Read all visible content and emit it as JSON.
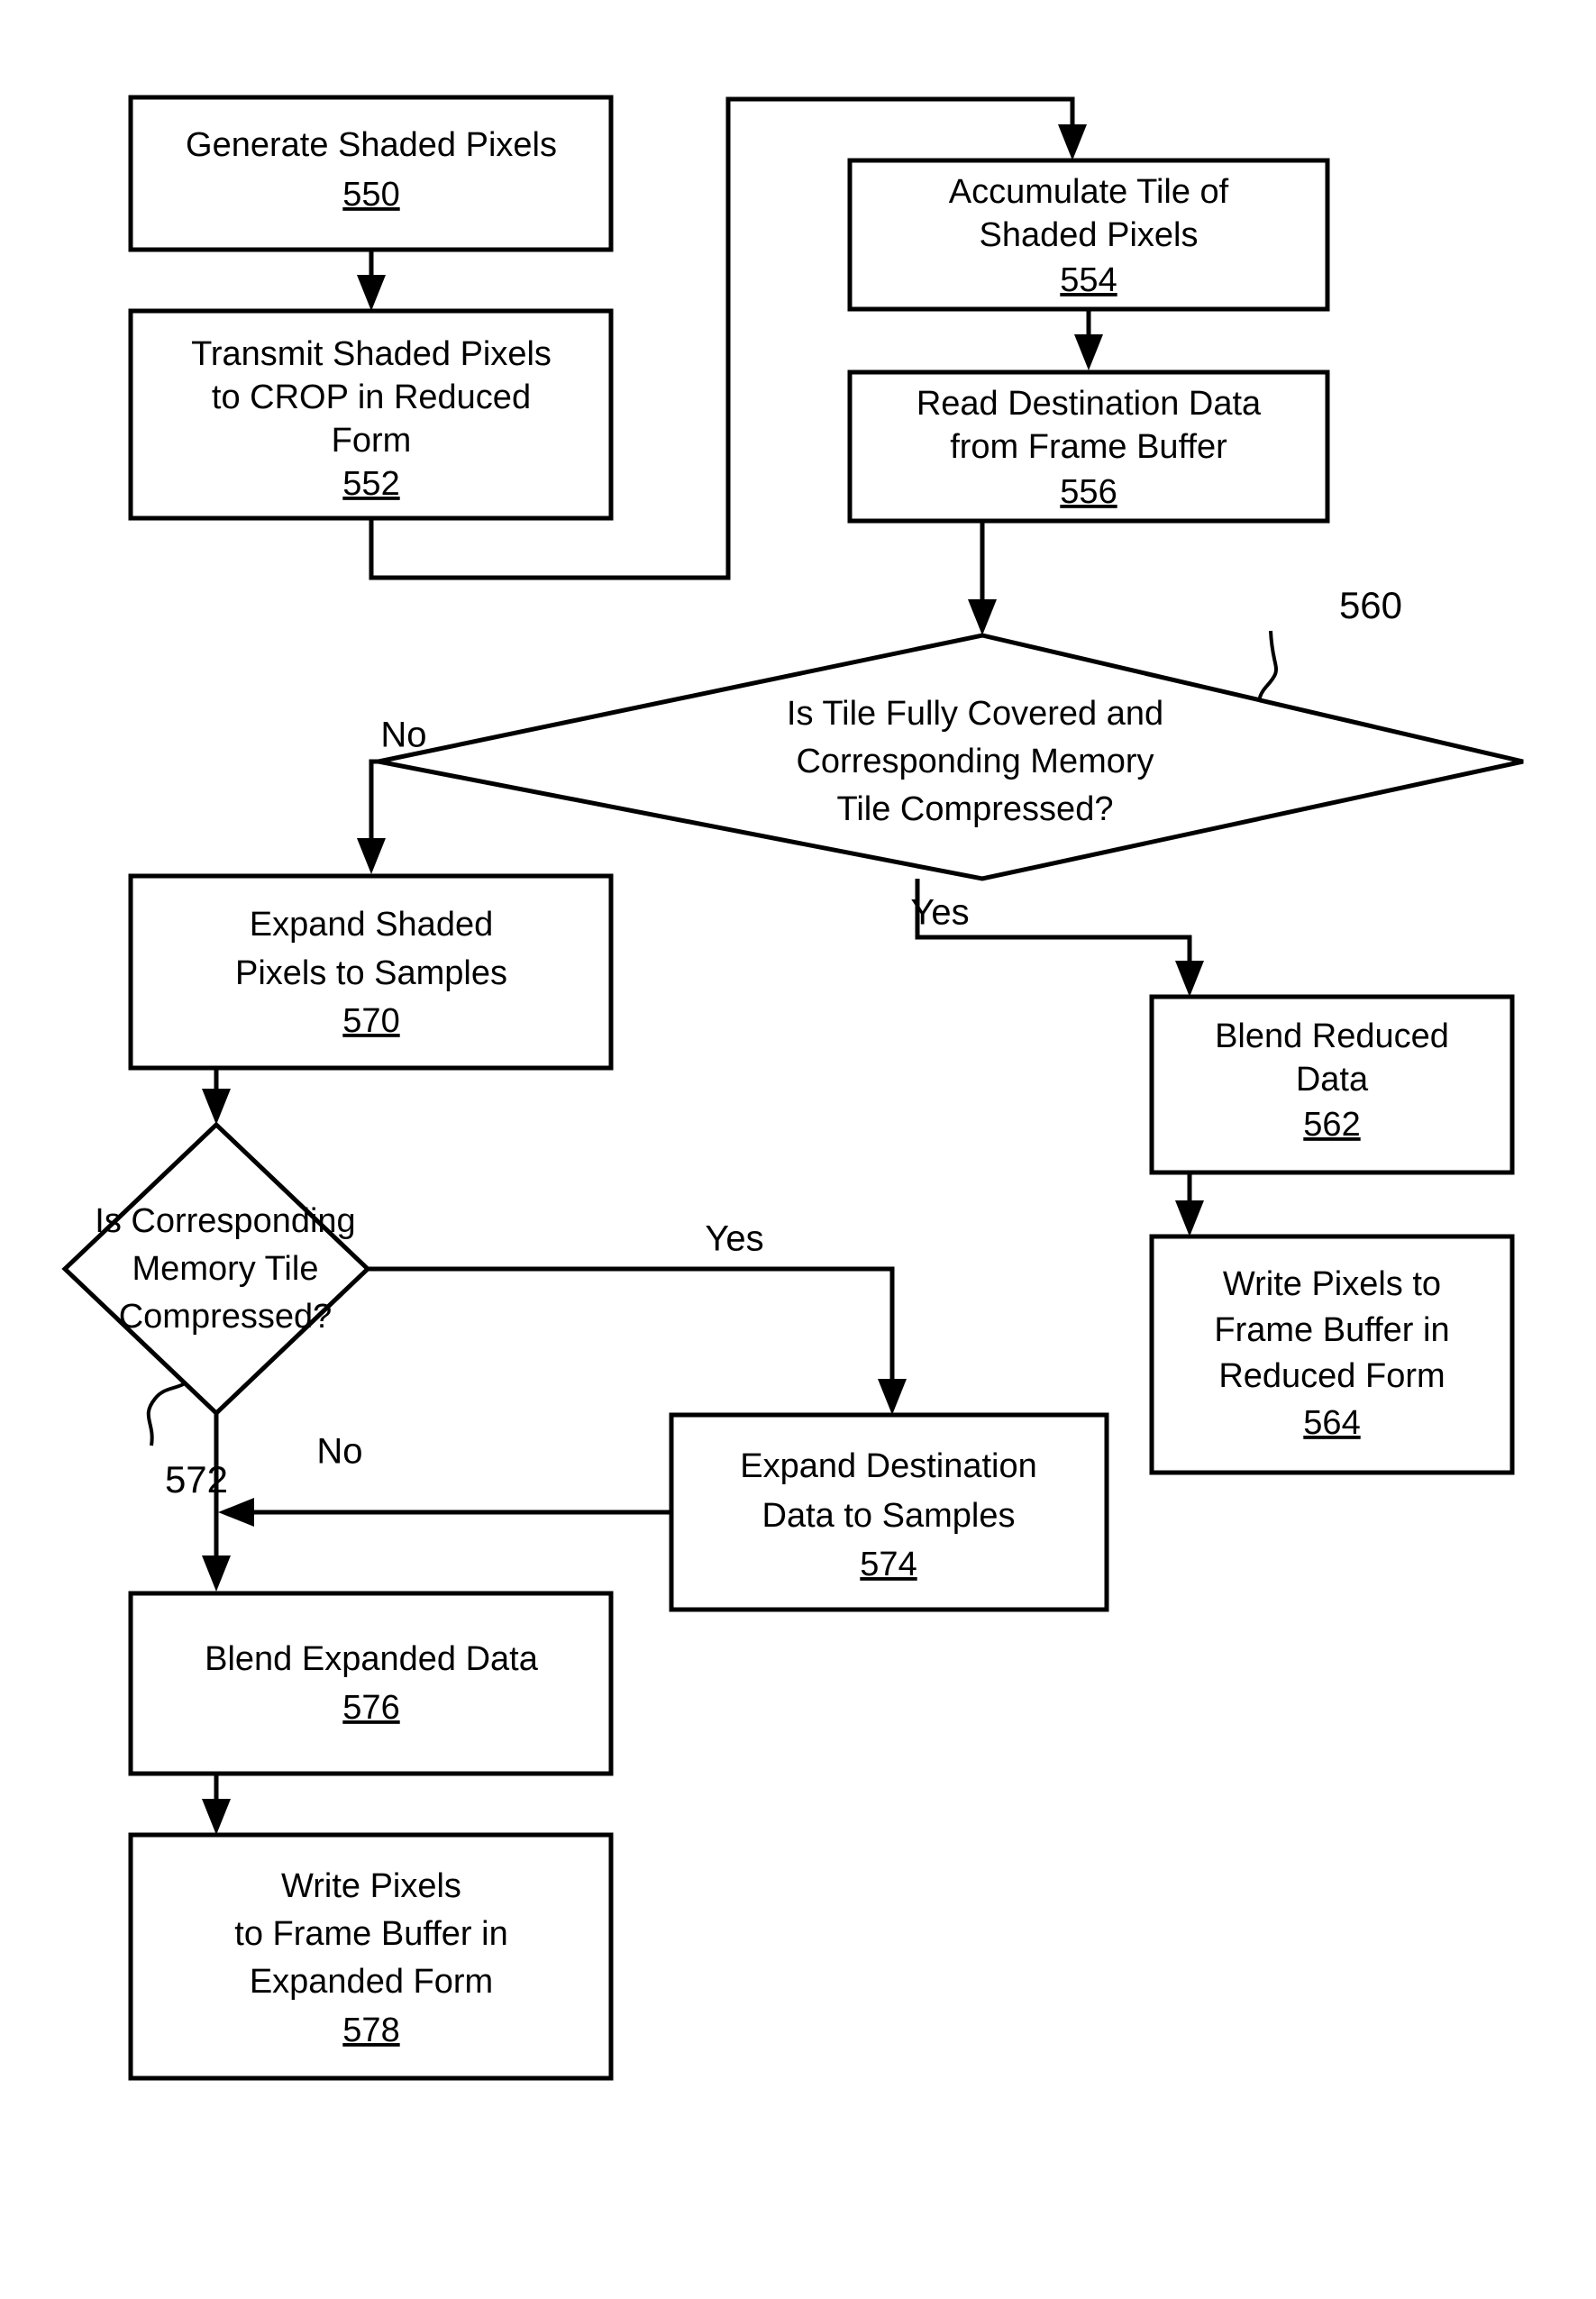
{
  "diagram": {
    "title": "Pixel Shading and Frame Buffer Blending Flowchart",
    "background_color": "#ffffff",
    "line_color": "#000000",
    "nodes": [
      {
        "id": "n550",
        "type": "process",
        "lines": [
          "Generate Shaded Pixels"
        ],
        "ref": "550"
      },
      {
        "id": "n552",
        "type": "process",
        "lines": [
          "Transmit Shaded Pixels",
          "to CROP in Reduced",
          "Form"
        ],
        "ref": "552"
      },
      {
        "id": "n554",
        "type": "process",
        "lines": [
          "Accumulate Tile of",
          "Shaded Pixels"
        ],
        "ref": "554"
      },
      {
        "id": "n556",
        "type": "process",
        "lines": [
          "Read Destination Data",
          "from  Frame Buffer"
        ],
        "ref": "556"
      },
      {
        "id": "n560",
        "type": "decision",
        "lines": [
          "Is Tile Fully Covered and",
          "Corresponding  Memory",
          "Tile Compressed?"
        ],
        "ref": "560"
      },
      {
        "id": "n562",
        "type": "process",
        "lines": [
          "Blend Reduced",
          "Data"
        ],
        "ref": "562"
      },
      {
        "id": "n564",
        "type": "process",
        "lines": [
          "Write Pixels to",
          "Frame Buffer in",
          "Reduced Form"
        ],
        "ref": "564"
      },
      {
        "id": "n570",
        "type": "process",
        "lines": [
          "Expand Shaded",
          "Pixels to Samples"
        ],
        "ref": "570"
      },
      {
        "id": "n572",
        "type": "decision",
        "lines": [
          "Is Corresponding",
          "Memory Tile",
          "Compressed?"
        ],
        "ref": "572"
      },
      {
        "id": "n574",
        "type": "process",
        "lines": [
          "Expand Destination",
          "Data to Samples"
        ],
        "ref": "574"
      },
      {
        "id": "n576",
        "type": "process",
        "lines": [
          "Blend Expanded Data"
        ],
        "ref": "576"
      },
      {
        "id": "n578",
        "type": "process",
        "lines": [
          "Write Pixels",
          "to Frame Buffer in",
          "Expanded Form"
        ],
        "ref": "578"
      }
    ],
    "edge_labels": {
      "d560_no": "No",
      "d560_yes": "Yes",
      "d572_yes": "Yes",
      "d572_no": "No"
    },
    "callouts": {
      "c560": "560",
      "c572": "572"
    }
  }
}
